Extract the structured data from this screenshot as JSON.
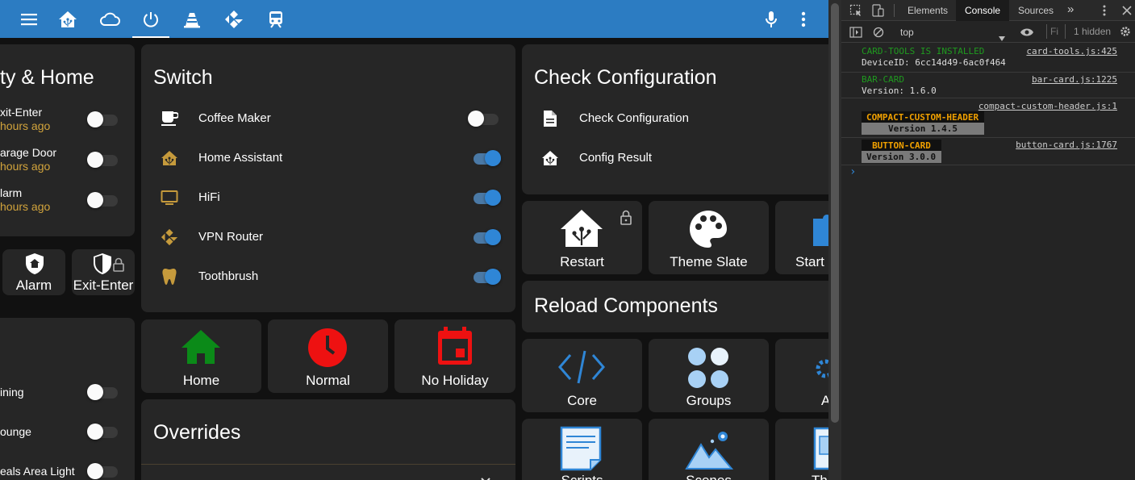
{
  "header": {
    "icons": [
      "menu-icon",
      "home-assistant-icon",
      "cloud-icon",
      "power-icon",
      "vlc-icon",
      "kodi-icon",
      "train-icon"
    ],
    "right_icons": [
      "microphone-icon",
      "dots-vertical-icon"
    ]
  },
  "security_card": {
    "title": "ty & Home",
    "entities": [
      {
        "name": "xit-Enter",
        "time": "hours ago",
        "state": "off"
      },
      {
        "name": "arage Door",
        "time": "hours ago",
        "state": "off"
      },
      {
        "name": "larm",
        "time": "hours ago",
        "state": "off"
      }
    ]
  },
  "security_buttons": [
    {
      "label": "Alarm",
      "icon": "shield-home-icon"
    },
    {
      "label": "Exit-Enter",
      "icon": "shield-lock-icon"
    }
  ],
  "lights_card": {
    "entities": [
      {
        "name": "ining",
        "state": "off"
      },
      {
        "name": "ounge",
        "state": "off"
      },
      {
        "name": "eals Area Light",
        "state": "off"
      }
    ]
  },
  "switch_card": {
    "title": "Switch",
    "entities": [
      {
        "name": "Coffee Maker",
        "icon": "coffee-icon",
        "state": "off"
      },
      {
        "name": "Home Assistant",
        "icon": "home-assistant-icon",
        "state": "on"
      },
      {
        "name": "HiFi",
        "icon": "television-icon",
        "state": "on"
      },
      {
        "name": "VPN Router",
        "icon": "kodi-icon",
        "state": "on"
      },
      {
        "name": "Toothbrush",
        "icon": "tooth-icon",
        "state": "on"
      }
    ]
  },
  "mode_buttons": [
    {
      "label": "Home",
      "icon": "home-icon",
      "color": "#0b8a18"
    },
    {
      "label": "Normal",
      "icon": "clock-icon",
      "color": "#ee1111"
    },
    {
      "label": "No Holiday",
      "icon": "calendar-icon",
      "color": "#ee1111"
    }
  ],
  "overrides_card": {
    "title": "Overrides"
  },
  "check_card": {
    "title": "Check Configuration",
    "rows": [
      {
        "label": "Check Configuration",
        "icon": "file-document-icon"
      },
      {
        "label": "Config Result",
        "icon": "home-assistant-icon"
      }
    ]
  },
  "server_buttons": [
    {
      "label": "Restart",
      "icon": "home-assistant-icon"
    },
    {
      "label": "Theme Slate",
      "icon": "palette-icon"
    },
    {
      "label": "Start",
      "icon": "puzzle-icon"
    }
  ],
  "reload_card": {
    "title": "Reload Components"
  },
  "reload_buttons": [
    {
      "label": "Core",
      "icon": "code-icon"
    },
    {
      "label": "Groups",
      "icon": "group-icon"
    },
    {
      "label": "A",
      "icon": "gear-icon"
    }
  ],
  "reload_buttons_2": [
    {
      "label": "Scripts",
      "icon": "script-icon"
    },
    {
      "label": "Scenes",
      "icon": "scenes-icon"
    },
    {
      "label": "Th",
      "icon": "theme-icon"
    }
  ],
  "devtools": {
    "tabs": [
      "Elements",
      "Console",
      "Sources"
    ],
    "active_tab": "Console",
    "context": "top",
    "filter_placeholder": "Fi",
    "hidden": "1 hidden",
    "logs": [
      {
        "text": "CARD-TOOLS IS INSTALLED",
        "text2": "DeviceID: 6cc14d49-6ac0f464",
        "source": "card-tools.js:425",
        "color": "#1f9a1f"
      },
      {
        "text": "BAR-CARD",
        "text2": "Version: 1.6.0",
        "source": "bar-card.js:1225",
        "color": "#1f9a1f"
      },
      {
        "text": "COMPACT-CUSTOM-HEADER",
        "text2": "Version 1.4.5",
        "source": "compact-custom-header.js:1",
        "color": "#f0a000"
      },
      {
        "text": "BUTTON-CARD",
        "text2": "Version 3.0.0",
        "source": "button-card.js:1767",
        "color": "#f0a000"
      }
    ],
    "prompt": "›"
  }
}
